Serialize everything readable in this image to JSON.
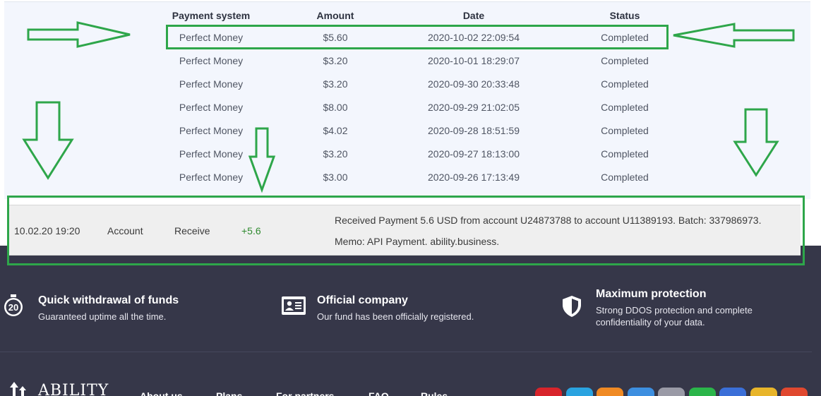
{
  "table": {
    "headers": {
      "system": "Payment system",
      "amount": "Amount",
      "date": "Date",
      "status": "Status"
    },
    "rows": [
      {
        "system": "Perfect Money",
        "amount": "$5.60",
        "date": "2020-10-02 22:09:54",
        "status": "Completed"
      },
      {
        "system": "Perfect Money",
        "amount": "$3.20",
        "date": "2020-10-01 18:29:07",
        "status": "Completed"
      },
      {
        "system": "Perfect Money",
        "amount": "$3.20",
        "date": "2020-09-30 20:33:48",
        "status": "Completed"
      },
      {
        "system": "Perfect Money",
        "amount": "$8.00",
        "date": "2020-09-29 21:02:05",
        "status": "Completed"
      },
      {
        "system": "Perfect Money",
        "amount": "$4.02",
        "date": "2020-09-28 18:51:59",
        "status": "Completed"
      },
      {
        "system": "Perfect Money",
        "amount": "$3.20",
        "date": "2020-09-27 18:13:00",
        "status": "Completed"
      },
      {
        "system": "Perfect Money",
        "amount": "$3.00",
        "date": "2020-09-26 17:13:49",
        "status": "Completed"
      }
    ]
  },
  "transaction": {
    "datetime": "10.02.20 19:20",
    "account": "Account",
    "type": "Receive",
    "amount": "+5.6",
    "description": "Received Payment 5.6 USD from account U24873788 to account U11389193. Batch: 337986973.",
    "memo": "Memo: API Payment. ability.business."
  },
  "footer": {
    "features": [
      {
        "icon": "stopwatch-20-icon",
        "badge": "20",
        "title": "Quick withdrawal of funds",
        "text": "Guaranteed uptime all the time."
      },
      {
        "icon": "id-card-icon",
        "title": "Official company",
        "text": "Our fund has been officially registered."
      },
      {
        "icon": "shield-icon",
        "title": "Maximum protection",
        "text": "Strong DDOS protection and complete confidentiality of your data."
      }
    ],
    "logo_text": "ABILITY",
    "nav": [
      "About us",
      "Plans",
      "For partners",
      "FAQ",
      "Rules"
    ],
    "payment_badges": [
      "#d8242b",
      "#2aa3e0",
      "#f08a24",
      "#3d8fe0",
      "#9a9aa6",
      "#2bb54a",
      "#3b6fd8",
      "#e8b52a",
      "#e0482f"
    ]
  },
  "colors": {
    "annotation": "#2ea64a",
    "footer_bg": "#363749",
    "panel_bg": "#f3f6fd",
    "positive_amount": "#2f8a2f"
  }
}
